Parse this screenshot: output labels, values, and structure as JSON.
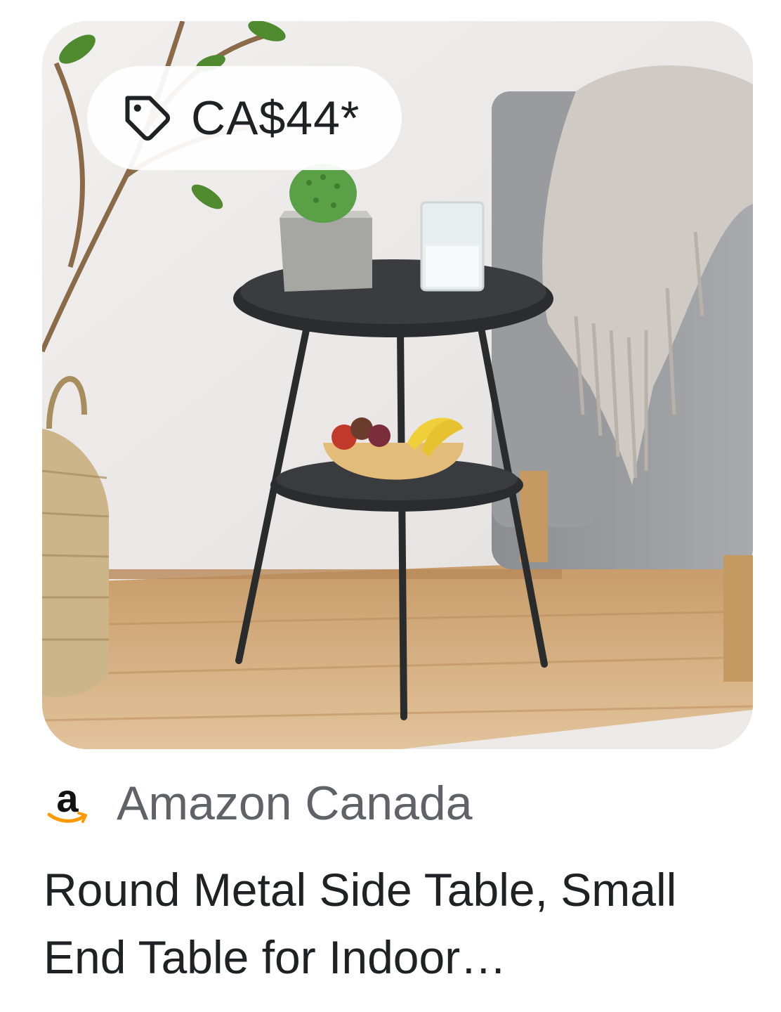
{
  "product": {
    "price": "CA$44*",
    "source_name": "Amazon Canada",
    "source_logo_letter": "a",
    "title": "Round Metal Side Table, Small End Table for Indoor…"
  },
  "icons": {
    "price": "tag-icon",
    "source": "amazon-logo-icon"
  },
  "colors": {
    "title_text": "#202124",
    "source_text": "#5f6368",
    "amazon_smile": "#ff9900"
  }
}
